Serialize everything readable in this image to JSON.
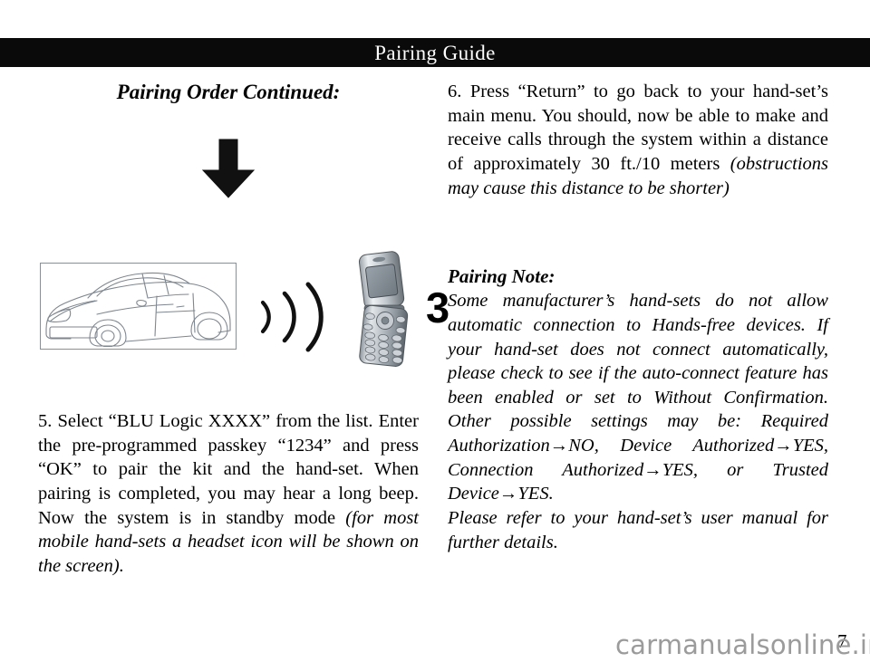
{
  "header": {
    "title": "Pairing Guide"
  },
  "left_column": {
    "heading": "Pairing Order Continued:",
    "arrow_icon": "down-arrow-icon",
    "illustration": {
      "car_icon": "car-line-art-icon",
      "signal_icon": "signal-waves-icon",
      "phone_icon": "flip-phone-icon",
      "step_number": "3"
    },
    "step5": {
      "text_part1": "5. Select “BLU Logic XXXX” from the list. Enter the pre-programmed passkey “1234” and press “OK” to pair the kit and the hand-set. When pairing is completed, you may hear a long beep.  Now the system is in standby mode ",
      "text_italic": "(for most mobile hand-sets a headset icon  will be shown on the screen)."
    }
  },
  "right_column": {
    "step6": {
      "text_part1": "6. Press “Return” to go back to your hand-set’s main menu.  You should, now be able to make and receive calls through the system within a distance of approximately 30 ft./10 meters ",
      "text_italic": "(obstructions may cause this distance to be shorter)"
    },
    "note": {
      "heading": "Pairing Note:",
      "body": "Some manufacturer’s hand-sets do not allow automatic connection to Hands-free devices. If your hand-set does not connect automatically, please check to see if the auto-connect feature has been enabled or set to Without Confirmation.  Other possible settings may be: Required Authorization→NO, Device Authorized→YES, Connection Authorized→YES, or Trusted Device→YES.",
      "tail": "Please refer to your hand-set’s user manual for further details."
    }
  },
  "footer": {
    "page_number": "7",
    "watermark": "carmanualsonline.info"
  },
  "colors": {
    "header_background": "#0a0a0a",
    "header_text": "#ffffff",
    "body_text": "#000000",
    "watermark_text": "#9b9b9b",
    "car_box_border": "#8a8f96"
  }
}
